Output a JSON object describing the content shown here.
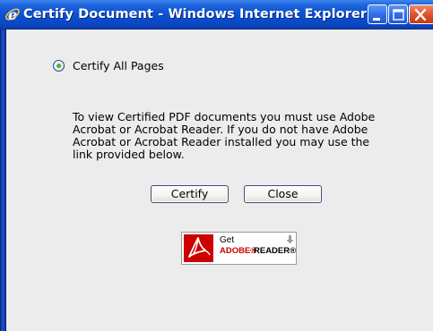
{
  "window": {
    "title": "Certify Document - Windows Internet Explorer"
  },
  "dialog": {
    "radio_label": "Certify All Pages",
    "radio_selected": true,
    "info_lines": [
      "To view Certified PDF documents you must use Adobe",
      "Acrobat or Acrobat Reader. If you do not have Adobe",
      "Acrobat or Acrobat Reader installed you may use the",
      "link provided below."
    ],
    "certify_label": "Certify",
    "close_label": "Close"
  },
  "adobe_badge": {
    "get": "Get",
    "brand": "ADOBE® ",
    "product": "READER®"
  },
  "colors": {
    "titlebar": "#0a4fd0",
    "close_button": "#e0532c",
    "adobe_red": "#cc0000",
    "background": "#ececec"
  },
  "icons": {
    "app": "ie-icon",
    "minimize": "minimize-icon",
    "maximize": "maximize-icon",
    "close": "close-icon",
    "adobe": "adobe-logo-icon",
    "download": "download-arrow-icon"
  }
}
